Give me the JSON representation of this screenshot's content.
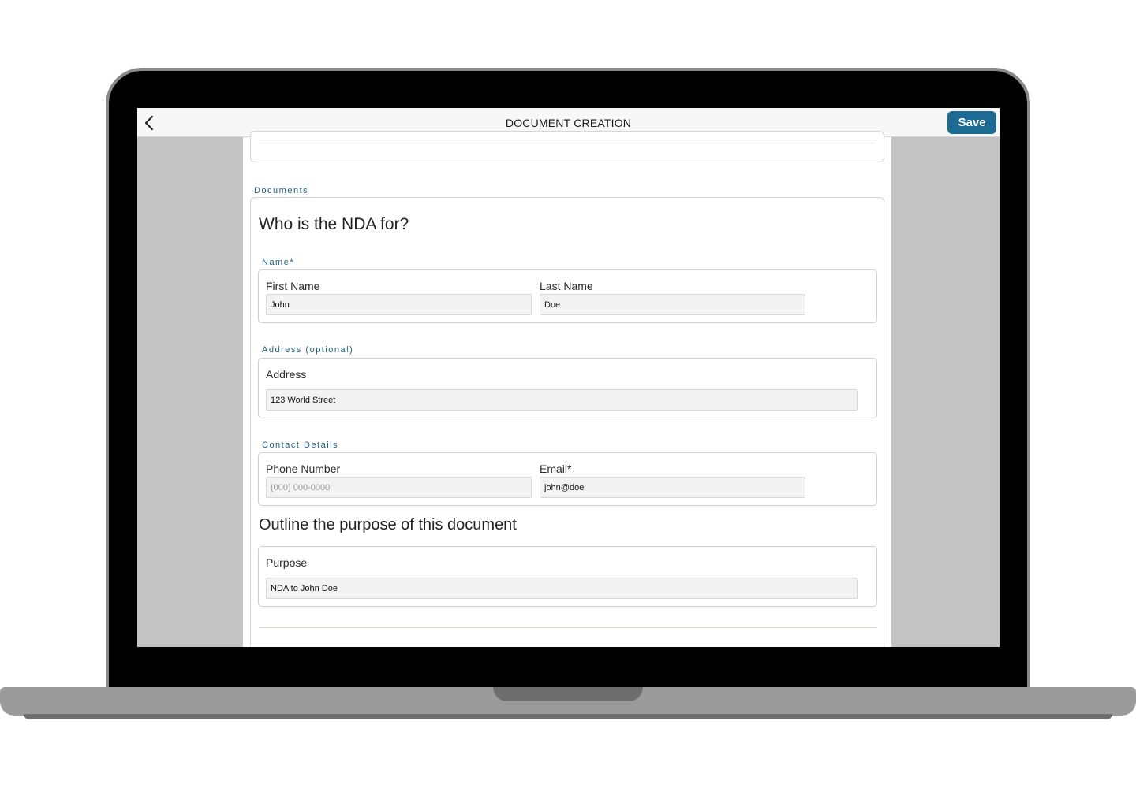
{
  "header": {
    "title": "DOCUMENT CREATION",
    "save_label": "Save",
    "back_icon": "chevron-left-icon"
  },
  "section": {
    "label": "Documents"
  },
  "nda_question": "Who is the NDA for?",
  "name_group": {
    "label": "Name*",
    "first_name": {
      "label": "First Name",
      "value": "John"
    },
    "last_name": {
      "label": "Last Name",
      "value": "Doe"
    }
  },
  "address_group": {
    "label": "Address (optional)",
    "address": {
      "label": "Address",
      "value": "123 World Street"
    }
  },
  "contact_group": {
    "label": "Contact Details",
    "phone": {
      "label": "Phone Number",
      "placeholder": "(000) 000-0000"
    },
    "email": {
      "label": "Email*",
      "value": "john@doe"
    }
  },
  "purpose_question": "Outline the purpose of this document",
  "purpose_group": {
    "purpose": {
      "label": "Purpose",
      "value": "NDA to John Doe"
    }
  },
  "colors": {
    "accent": "#1b6b94",
    "section_label": "#1f5f80",
    "screen_background": "#c3c3c3",
    "input_background": "#f3f3f3"
  }
}
